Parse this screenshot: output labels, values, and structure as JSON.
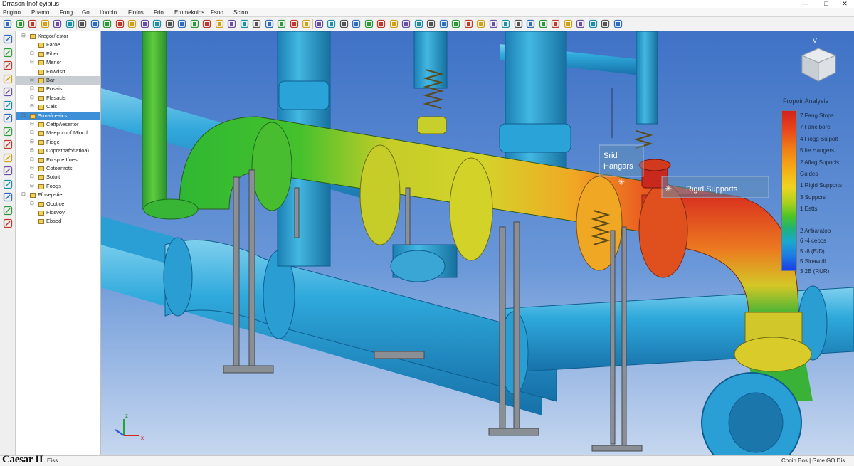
{
  "window": {
    "title": "Drrason Inof eyipius",
    "minimize_glyph": "—",
    "maximize_glyph": "□",
    "close_glyph": "✕"
  },
  "menu": [
    "Pngino",
    "Pnamo",
    "Fong",
    "Go",
    "Ifoobio",
    "Fiofos",
    "Frio",
    "Eromeknins",
    "Fsno",
    "Scino"
  ],
  "tree": [
    {
      "label": "Kregor/lestor",
      "expander": "⊟",
      "level": 0,
      "style": ""
    },
    {
      "label": "Faroe",
      "expander": "",
      "level": 1,
      "style": ""
    },
    {
      "label": "Fiber",
      "expander": "⊟",
      "level": 1,
      "style": ""
    },
    {
      "label": "Menor",
      "expander": "⊟",
      "level": 1,
      "style": ""
    },
    {
      "label": "Fowdsrt",
      "expander": "",
      "level": 1,
      "style": ""
    },
    {
      "label": "Bar",
      "expander": "⊟",
      "level": 1,
      "style": "sel-grey"
    },
    {
      "label": "Posais",
      "expander": "⊟",
      "level": 1,
      "style": ""
    },
    {
      "label": "Flesacls",
      "expander": "⊟",
      "level": 1,
      "style": ""
    },
    {
      "label": "Cais",
      "expander": "⊟",
      "level": 1,
      "style": ""
    },
    {
      "label": "Srmafceaics",
      "expander": "⊟",
      "level": 0,
      "style": "sel-blue"
    },
    {
      "label": "Cettp/\\esertor",
      "expander": "⊟",
      "level": 1,
      "style": ""
    },
    {
      "label": "Maepproof Mlocd",
      "expander": "⊟",
      "level": 1,
      "style": ""
    },
    {
      "label": "Fioge",
      "expander": "⊟",
      "level": 1,
      "style": ""
    },
    {
      "label": "Copratbafo/tatioa)",
      "expander": "⊟",
      "level": 1,
      "style": ""
    },
    {
      "label": "Fotspre Ifoes",
      "expander": "⊟",
      "level": 1,
      "style": ""
    },
    {
      "label": "Cotoanrots",
      "expander": "⊟",
      "level": 1,
      "style": ""
    },
    {
      "label": "Sotoit",
      "expander": "⊟",
      "level": 1,
      "style": ""
    },
    {
      "label": "Foogs",
      "expander": "⊟",
      "level": 1,
      "style": ""
    },
    {
      "label": "Ffosepstie",
      "expander": "⊟",
      "level": 0,
      "style": ""
    },
    {
      "label": "Ocotice",
      "expander": "⊟",
      "level": 1,
      "style": ""
    },
    {
      "label": "Fiosvoy",
      "expander": "",
      "level": 1,
      "style": ""
    },
    {
      "label": "Ebsod",
      "expander": "",
      "level": 1,
      "style": ""
    }
  ],
  "legend": {
    "title": "Fropoir Analysis",
    "items": [
      "7 Fang Stops",
      "7 Fanc bore",
      "4 Fiogg Sujpolt",
      "5 Ite Hangers",
      "2 Afiag Supocis",
      "Guides",
      "1 Rigid Supports",
      "3 Suppcrs",
      "1 Estts",
      "2 Anbaratop",
      "6 -4 ceocs",
      "5 -8 (E/D)",
      "5 Sioawi/ll",
      "3 2B (RUR)"
    ],
    "colors": [
      "#d2231d",
      "#f07f16",
      "#eed520",
      "#4cc424",
      "#1ca8cc",
      "#1a3de6"
    ]
  },
  "callouts": {
    "spring_hangers": [
      "Srid",
      "Hangars"
    ],
    "rigid_supports": "Rigid Supports"
  },
  "viewcube": {
    "axis_label": "V"
  },
  "triad": {
    "z": "z",
    "x": "x"
  },
  "status": {
    "logo": "Caesar II",
    "left_text": "Eiss",
    "right_text": "Choin Bos | Gme GO Dis"
  },
  "toolbar_icons": [
    "open-icon",
    "undo-icon",
    "print-icon",
    "new-icon",
    "edit-icon",
    "save-icon",
    "zoom-icon",
    "refresh-icon",
    "rotate-icon",
    "pan-icon",
    "pipe-icon",
    "flange-icon",
    "valve-icon",
    "bend-icon",
    "tee-icon",
    "support-icon",
    "hanger-icon",
    "restraint-icon",
    "node-icon",
    "measure-icon",
    "check-icon",
    "list-icon",
    "table-icon",
    "plot-icon",
    "stress-icon",
    "run-icon",
    "report-icon",
    "grid-icon",
    "layer-icon",
    "section-icon",
    "cut-icon",
    "copy-icon",
    "paste-icon",
    "find-icon",
    "filter-icon",
    "load-icon",
    "fit-icon",
    "help-icon",
    "settings-icon",
    "camera-icon",
    "light-icon",
    "render-icon",
    "info-icon",
    "tag-icon",
    "home-icon",
    "diamond-icon",
    "target-icon",
    "search-icon",
    "tool-icon",
    "export-icon"
  ],
  "side_icons": [
    "select-icon",
    "pipe-draw-icon",
    "grid-view-icon",
    "link-icon",
    "calculator-icon",
    "memory-icon",
    "monitor-icon",
    "clipboard-icon",
    "pen-icon",
    "eraser-icon",
    "layers-icon",
    "folder-icon",
    "stack-icon",
    "tools-icon",
    "axis-icon"
  ]
}
